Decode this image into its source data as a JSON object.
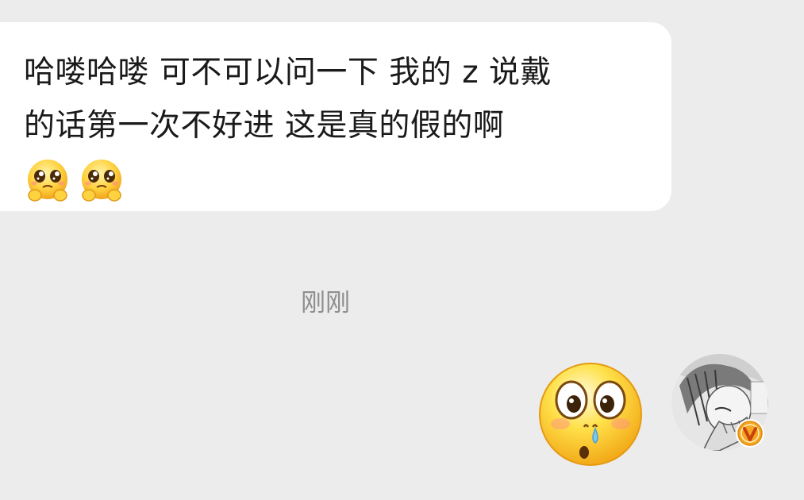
{
  "message": {
    "line1": "哈喽哈喽 可不可以问一下 我的 z 说戴",
    "line2": "的话第一次不好进 这是真的假的啊",
    "emojis": [
      "pleading-face-icon",
      "pleading-face-icon"
    ]
  },
  "timestamp": "刚刚",
  "reply_sticker": "shocked-face-icon",
  "sender_avatar": {
    "badge": "v-badge-icon"
  },
  "colors": {
    "background": "#ececec",
    "bubble": "#ffffff",
    "text": "#1a1a1a",
    "timestamp": "#8e8e8e",
    "badge": "#f5a623"
  }
}
